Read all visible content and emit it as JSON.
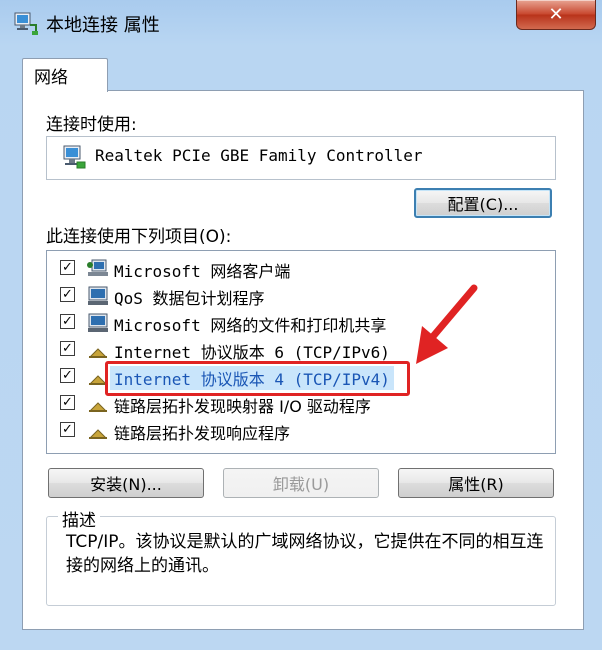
{
  "window": {
    "title": "本地连接 属性",
    "close_label": "✕"
  },
  "tabs": [
    {
      "label": "网络"
    }
  ],
  "connect_using": {
    "label": "连接时使用:",
    "adapter_name": "Realtek PCIe GBE Family Controller",
    "configure_label": "配置(C)..."
  },
  "items_section": {
    "label": "此连接使用下列项目(O):",
    "items": [
      {
        "checked": true,
        "icon": "network-client-icon",
        "label": "Microsoft 网络客户端",
        "selected": false
      },
      {
        "checked": true,
        "icon": "qos-icon",
        "label": "QoS 数据包计划程序",
        "selected": false
      },
      {
        "checked": true,
        "icon": "file-sharing-icon",
        "label": "Microsoft 网络的文件和打印机共享",
        "selected": false
      },
      {
        "checked": true,
        "icon": "protocol-icon",
        "label": "Internet 协议版本 6 (TCP/IPv6)",
        "selected": false
      },
      {
        "checked": true,
        "icon": "protocol-icon",
        "label": "Internet 协议版本 4 (TCP/IPv4)",
        "selected": true
      },
      {
        "checked": true,
        "icon": "protocol-icon",
        "label": "链路层拓扑发现映射器 I/O 驱动程序",
        "selected": false
      },
      {
        "checked": true,
        "icon": "protocol-icon",
        "label": "链路层拓扑发现响应程序",
        "selected": false
      }
    ]
  },
  "buttons": {
    "install": "安装(N)...",
    "uninstall": "卸载(U)",
    "properties": "属性(R)"
  },
  "description": {
    "title": "描述",
    "text": "TCP/IP。该协议是默认的广域网络协议，它提供在不同的相互连接的网络上的通讯。"
  },
  "colors": {
    "highlight_border": "#e02323",
    "selection_bg": "#c9e5fb",
    "selection_text": "#1a56b5"
  }
}
